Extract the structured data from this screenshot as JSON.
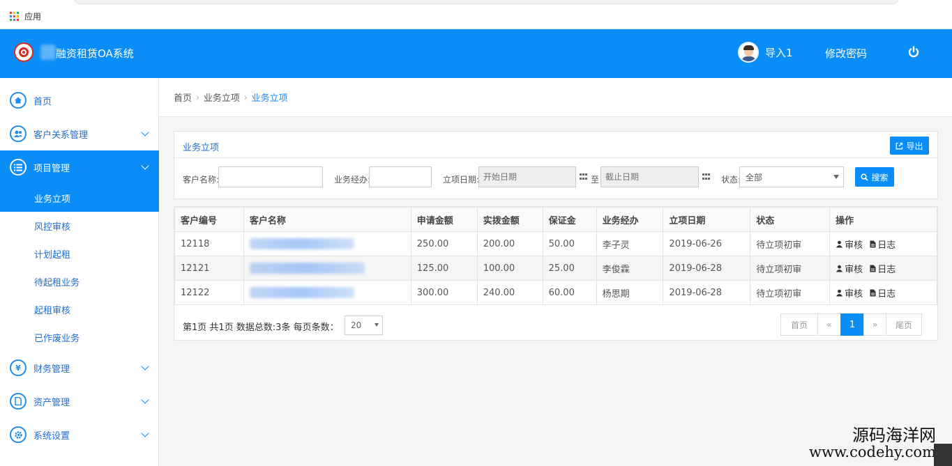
{
  "browser": {
    "bookmarks_label": "应用"
  },
  "header": {
    "app_title": "融资租赁OA系统",
    "user_name": "导入1",
    "change_password": "修改密码",
    "colors": {
      "primary": "#0a8df7"
    }
  },
  "sidebar": {
    "items": [
      {
        "label": "首页",
        "icon": "home-icon"
      },
      {
        "label": "客户关系管理",
        "icon": "users-icon"
      },
      {
        "label": "项目管理",
        "icon": "list-icon"
      },
      {
        "label": "财务管理",
        "icon": "yen-icon"
      },
      {
        "label": "资产管理",
        "icon": "document-icon"
      },
      {
        "label": "系统设置",
        "icon": "gear-icon"
      }
    ],
    "sub_items": [
      "业务立项",
      "风控审核",
      "计划起租",
      "待起租业务",
      "起租审核",
      "已作废业务"
    ]
  },
  "breadcrumb": {
    "home": "首页",
    "parent": "业务立项",
    "current": "业务立项"
  },
  "panel": {
    "title": "业务立项",
    "export_label": "导出",
    "filters": {
      "customer_name_label": "客户名称:",
      "manager_label": "业务经办:",
      "date_label": "立项日期:",
      "start_placeholder": "开始日期",
      "to_label": "至",
      "end_placeholder": "截止日期",
      "status_label": "状态:",
      "status_value": "全部",
      "search_label": "搜索"
    }
  },
  "table": {
    "headers": [
      "客户编号",
      "客户名称",
      "申请金额",
      "实拨金额",
      "保证金",
      "业务经办",
      "立项日期",
      "状态",
      "操作"
    ],
    "rows": [
      {
        "id": "12118",
        "apply": "250.00",
        "paid": "200.00",
        "deposit": "50.00",
        "manager": "李子灵",
        "date": "2019-06-26",
        "status": "待立项初审"
      },
      {
        "id": "12121",
        "apply": "125.00",
        "paid": "100.00",
        "deposit": "25.00",
        "manager": "李俊霖",
        "date": "2019-06-28",
        "status": "待立项初审"
      },
      {
        "id": "12122",
        "apply": "300.00",
        "paid": "240.00",
        "deposit": "60.00",
        "manager": "杨思期",
        "date": "2019-06-28",
        "status": "待立项初审"
      }
    ],
    "ops": {
      "review": "审核",
      "log": "日志"
    }
  },
  "pager": {
    "info": "第1页 共1页 数据总数:3条 每页条数：",
    "page_size": "20",
    "first": "首页",
    "prev": "«",
    "current": "1",
    "next": "»",
    "last": "尾页"
  },
  "watermark": {
    "line1": "源码海洋网",
    "line2": "www.codehy.com"
  }
}
